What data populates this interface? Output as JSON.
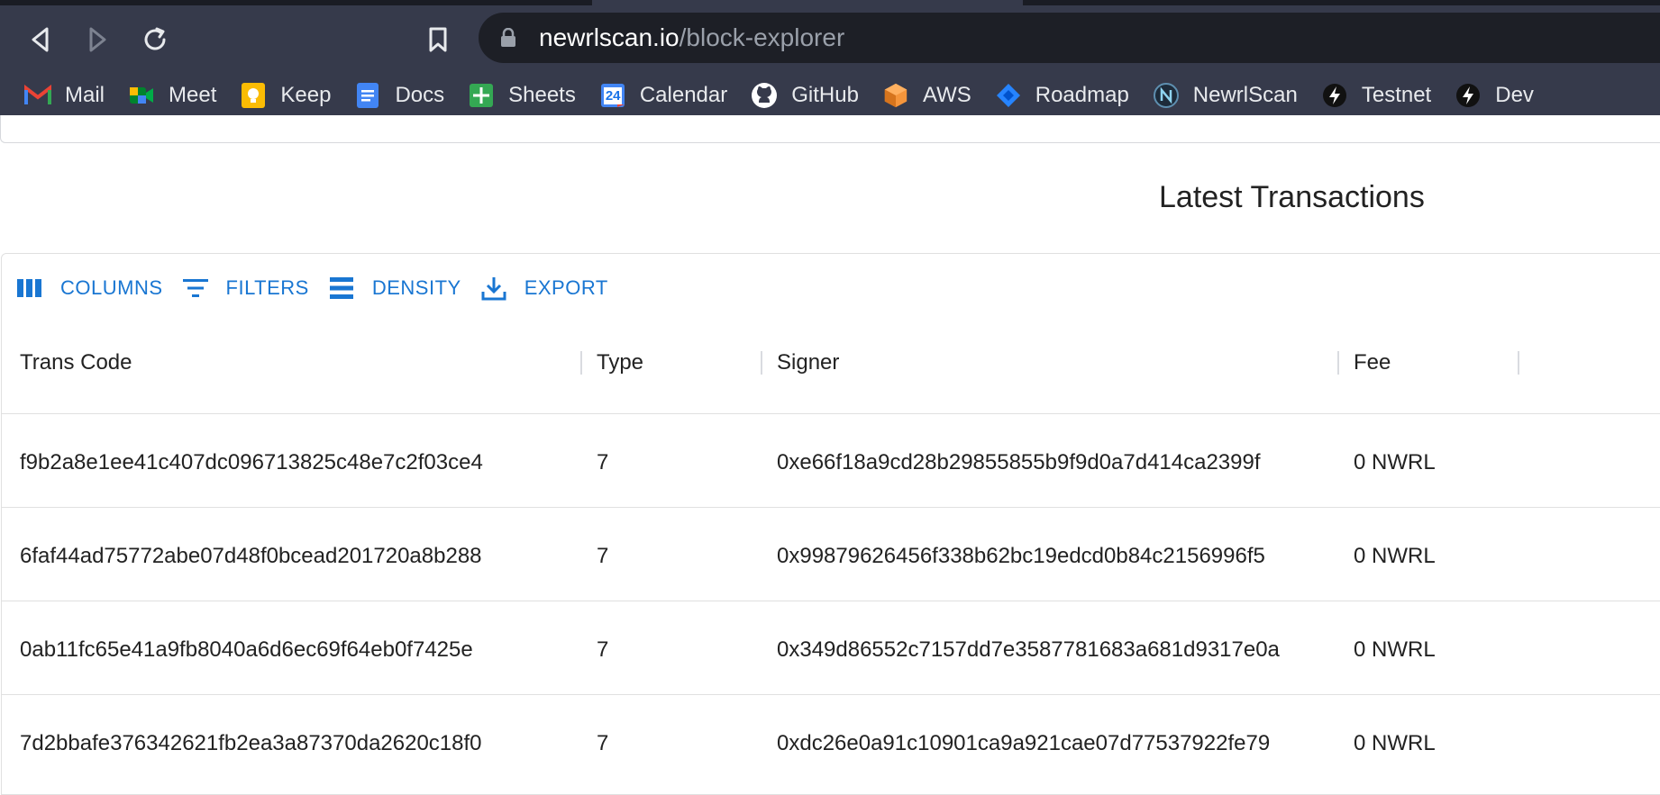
{
  "browser": {
    "url_host": "newrlscan.io",
    "url_path": "/block-explorer",
    "bookmarks": [
      {
        "label": "Mail",
        "icon": "gmail-icon"
      },
      {
        "label": "Meet",
        "icon": "meet-icon"
      },
      {
        "label": "Keep",
        "icon": "keep-icon"
      },
      {
        "label": "Docs",
        "icon": "docs-icon"
      },
      {
        "label": "Sheets",
        "icon": "sheets-icon"
      },
      {
        "label": "Calendar",
        "icon": "calendar-icon"
      },
      {
        "label": "GitHub",
        "icon": "github-icon"
      },
      {
        "label": "AWS",
        "icon": "aws-icon"
      },
      {
        "label": "Roadmap",
        "icon": "jira-icon"
      },
      {
        "label": "NewrlScan",
        "icon": "newrlscan-icon"
      },
      {
        "label": "Testnet",
        "icon": "bolt-icon"
      },
      {
        "label": "Dev",
        "icon": "bolt-icon"
      }
    ],
    "calendar_day": "24"
  },
  "page": {
    "section_title": "Latest Transactions",
    "toolbar": {
      "columns": "COLUMNS",
      "filters": "FILTERS",
      "density": "DENSITY",
      "export": "EXPORT"
    },
    "table": {
      "headers": [
        "Trans Code",
        "Type",
        "Signer",
        "Fee"
      ],
      "rows": [
        {
          "code": "f9b2a8e1ee41c407dc096713825c48e7c2f03ce4",
          "type": "7",
          "signer": "0xe66f18a9cd28b29855855b9f9d0a7d414ca2399f",
          "fee": "0 NWRL"
        },
        {
          "code": "6faf44ad75772abe07d48f0bcead201720a8b288",
          "type": "7",
          "signer": "0x99879626456f338b62bc19edcd0b84c2156996f5",
          "fee": "0 NWRL"
        },
        {
          "code": "0ab11fc65e41a9fb8040a6d6ec69f64eb0f7425e",
          "type": "7",
          "signer": "0x349d86552c7157dd7e3587781683a681d9317e0a",
          "fee": "0 NWRL"
        },
        {
          "code": "7d2bbafe376342621fb2ea3a87370da2620c18f0",
          "type": "7",
          "signer": "0xdc26e0a91c10901ca9a921cae07d77537922fe79",
          "fee": "0 NWRL"
        }
      ]
    }
  },
  "colors": {
    "accent": "#1976d2",
    "chrome": "#363a4b",
    "urlbar": "#1d1f26"
  }
}
